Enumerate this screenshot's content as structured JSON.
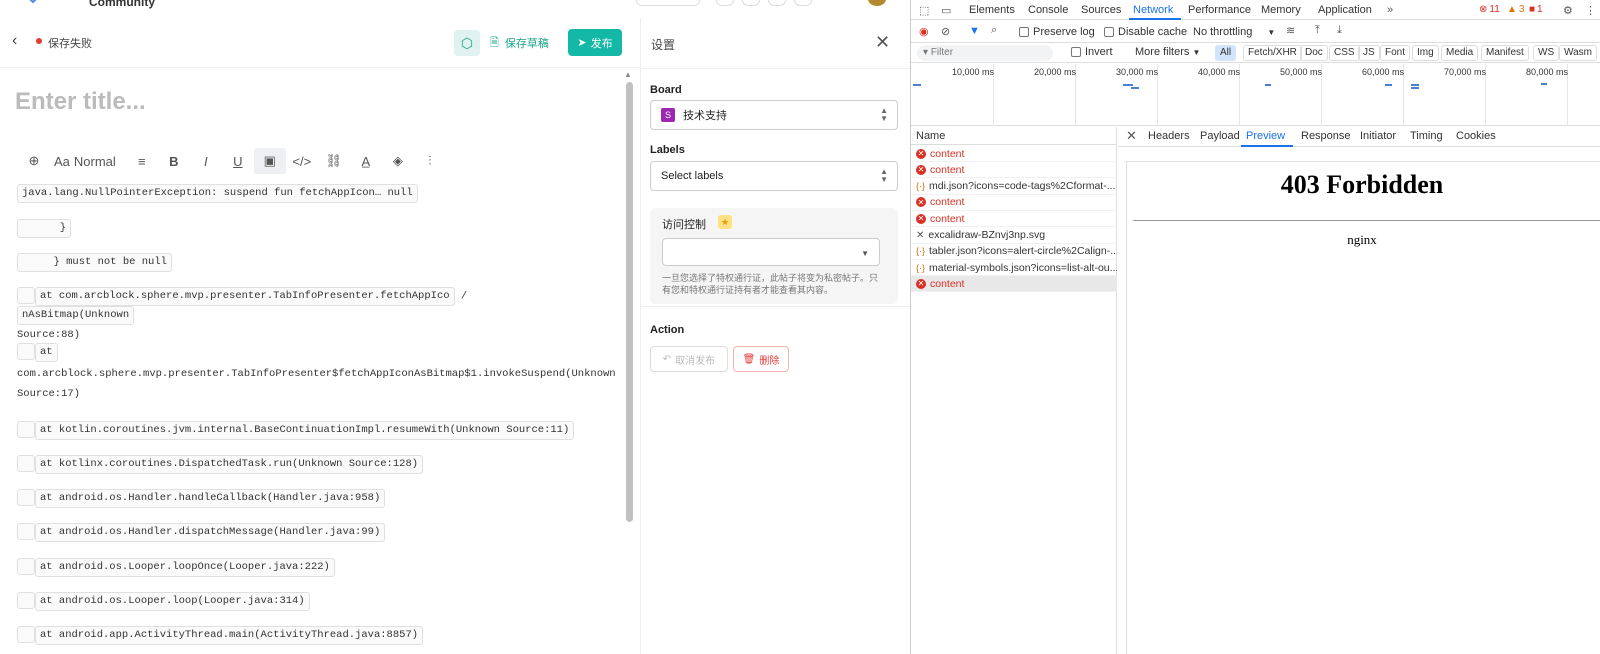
{
  "header_top": {
    "community_label": "Community"
  },
  "editor": {
    "status_text": "保存失败",
    "draft_label": "保存草稿",
    "publish_label": "发布",
    "title_placeholder": "Enter title...",
    "format_label": "Normal",
    "code_lines": [
      "java.lang.NullPointerException: suspend fun fetchAppIcon…        null",
      "      }",
      "     } must not be null",
      "at com.arcblock.sphere.mvp.presenter.TabInfoPresenter.fetchAppIco",
      "nAsBitmap(Unknown",
      "Source:88)",
      "at",
      "com.arcblock.sphere.mvp.presenter.TabInfoPresenter$fetchAppIconAsBitmap$1.invokeSuspend(Unknown",
      "Source:17)",
      "at kotlin.coroutines.jvm.internal.BaseContinuationImpl.resumeWith(Unknown Source:11)",
      "at kotlinx.coroutines.DispatchedTask.run(Unknown Source:128)",
      "at android.os.Handler.handleCallback(Handler.java:958)",
      "at android.os.Handler.dispatchMessage(Handler.java:99)",
      "at android.os.Looper.loopOnce(Looper.java:222)",
      "at android.os.Looper.loop(Looper.java:314)",
      "at android.app.ActivityThread.main(ActivityThread.java:8857)"
    ]
  },
  "settings": {
    "title": "设置",
    "board_label": "Board",
    "board_value": "技术支持",
    "board_badge": "S",
    "labels_label": "Labels",
    "labels_placeholder": "Select labels",
    "access_title": "访问控制",
    "access_help": "一旦您选择了特权通行证，此帖子将变为私密帖子。只有您和特权通行证持有者才能查看其内容。",
    "action_label": "Action",
    "unpublish_label": "取消发布",
    "delete_label": "删除"
  },
  "devtools": {
    "tabs": [
      "Elements",
      "Console",
      "Sources",
      "Network",
      "Performance",
      "Memory",
      "Application"
    ],
    "active_tab": "Network",
    "errors": "11",
    "warnings": "3",
    "issues": "1",
    "preserve_log": "Preserve log",
    "disable_cache": "Disable cache",
    "throttling": "No throttling",
    "filter_placeholder": "Filter",
    "invert": "Invert",
    "more_filters": "More filters",
    "type_filters": [
      "All",
      "Fetch/XHR",
      "Doc",
      "CSS",
      "JS",
      "Font",
      "Img",
      "Media",
      "Manifest",
      "WS",
      "Wasm"
    ],
    "timeline_ticks": [
      "10,000 ms",
      "20,000 ms",
      "30,000 ms",
      "40,000 ms",
      "50,000 ms",
      "60,000 ms",
      "70,000 ms",
      "80,000 ms"
    ],
    "name_header": "Name",
    "requests": [
      {
        "name": "content",
        "kind": "error"
      },
      {
        "name": "content",
        "kind": "error"
      },
      {
        "name": "mdi.json?icons=code-tags%2Cformat-...",
        "kind": "json"
      },
      {
        "name": "content",
        "kind": "error"
      },
      {
        "name": "content",
        "kind": "error"
      },
      {
        "name": "excalidraw-BZnvj3np.svg",
        "kind": "canceled"
      },
      {
        "name": "tabler.json?icons=alert-circle%2Calign-...",
        "kind": "json"
      },
      {
        "name": "material-symbols.json?icons=list-alt-ou...",
        "kind": "json"
      },
      {
        "name": "content",
        "kind": "error"
      }
    ],
    "detail_tabs": [
      "Headers",
      "Payload",
      "Preview",
      "Response",
      "Initiator",
      "Timing",
      "Cookies"
    ],
    "active_detail_tab": "Preview",
    "preview_heading": "403 Forbidden",
    "preview_server": "nginx"
  }
}
